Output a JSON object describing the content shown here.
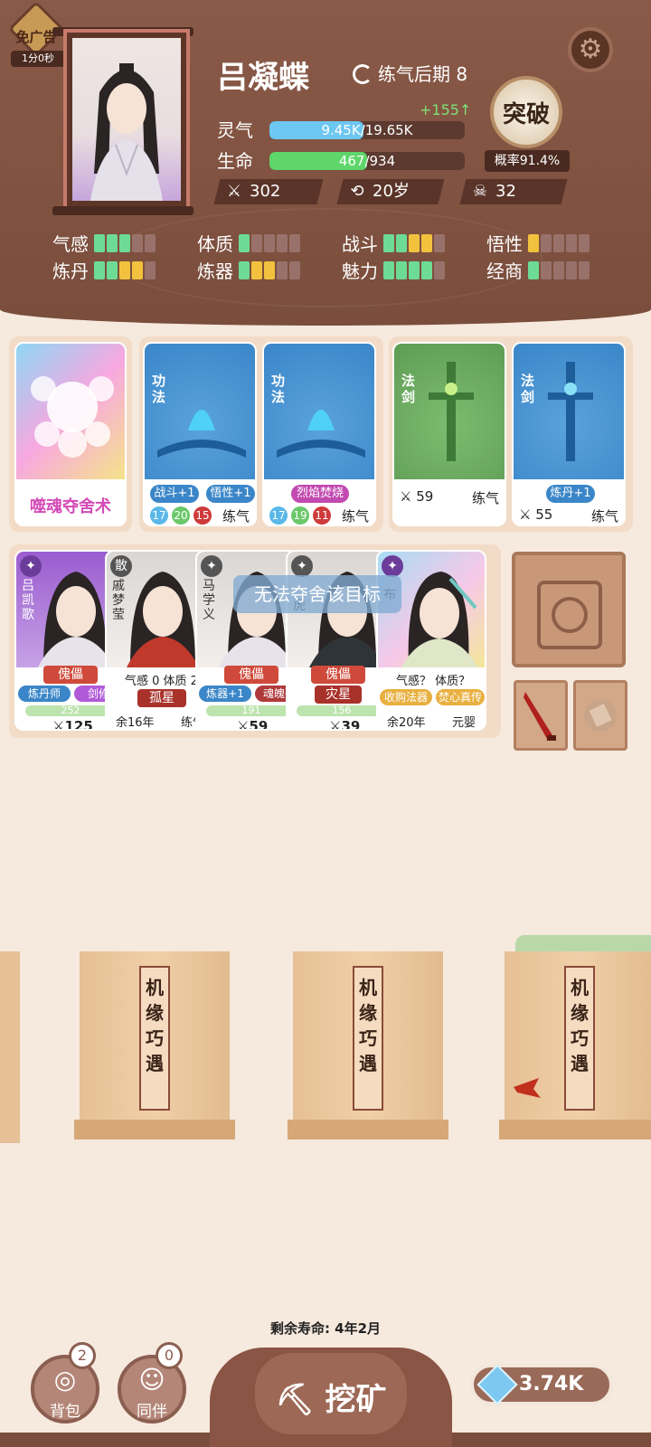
{
  "header": {
    "ad_badge": "免广告",
    "ad_timer": "1分0秒",
    "player_name": "吕凝蝶",
    "realm": "练气后期 8",
    "qi_gain": "+155↑",
    "qi_label": "灵气",
    "qi_value": "9.45K/19.65K",
    "qi_fraction": 0.48,
    "hp_label": "生命",
    "hp_value": "467/934",
    "hp_fraction": 0.5,
    "breakthrough_label": "突破",
    "breakthrough_rate": "概率91.4%",
    "power": "302",
    "age": "20岁",
    "kills": "32"
  },
  "attributes": [
    {
      "label": "气感",
      "pips": [
        "g",
        "g",
        "g",
        "n",
        "n"
      ]
    },
    {
      "label": "体质",
      "pips": [
        "g",
        "n",
        "n",
        "n",
        "n"
      ]
    },
    {
      "label": "战斗",
      "pips": [
        "g",
        "g",
        "y",
        "y",
        "n"
      ]
    },
    {
      "label": "悟性",
      "pips": [
        "y",
        "n",
        "n",
        "n",
        "n"
      ]
    },
    {
      "label": "炼丹",
      "pips": [
        "g",
        "g",
        "y",
        "y",
        "n"
      ]
    },
    {
      "label": "炼器",
      "pips": [
        "g",
        "y",
        "y",
        "n",
        "n"
      ]
    },
    {
      "label": "魅力",
      "pips": [
        "g",
        "g",
        "g",
        "g",
        "n"
      ]
    },
    {
      "label": "经商",
      "pips": [
        "g",
        "n",
        "n",
        "n",
        "n"
      ]
    }
  ],
  "cards": {
    "soul": {
      "title": "噬魂夺舍术"
    },
    "gongfa1": {
      "type": "功法",
      "tag1": "战斗+1",
      "tag2": "悟性+1",
      "n1": "17",
      "n2": "20",
      "n3": "15",
      "realm": "练气"
    },
    "gongfa2": {
      "type": "功法",
      "tag1": "烈焰焚烧",
      "n1": "17",
      "n2": "19",
      "n3": "11",
      "realm": "练气"
    },
    "sword1": {
      "type": "法剑",
      "power": "59",
      "realm": "练气"
    },
    "sword2": {
      "type": "法剑",
      "tag1": "炼丹+1",
      "power": "55",
      "realm": "练气"
    }
  },
  "companions": [
    {
      "name": "吕凯歌",
      "status": "傀儡",
      "tag1": "炼丹师",
      "tag2": "剑修",
      "hp": "252",
      "power": "125"
    },
    {
      "corner": "散",
      "name": "戚梦莹",
      "line1": "气感 0  体质 2",
      "status": "孤星",
      "years": "余16年",
      "realm": "练气"
    },
    {
      "name": "马学义",
      "status": "傀儡",
      "tag1": "炼器+1",
      "tag2": "魂魄残",
      "hp": "191",
      "power": "59"
    },
    {
      "name": "虎",
      "status": "傀儡",
      "status2": "灾星",
      "hp": "156",
      "power": "39"
    },
    {
      "name": "布",
      "line1": "气感？ 体质？",
      "tag1": "收购法器",
      "tag2": "焚心真传",
      "years": "余20年",
      "realm": "元婴"
    }
  ],
  "toast": "无法夺舍该目标",
  "bags": [
    {
      "label": "机缘巧遇"
    },
    {
      "label": "机缘巧遇"
    },
    {
      "label": "机缘巧遇"
    }
  ],
  "bottom": {
    "lifespan": "剩余寿命: 4年2月",
    "backpack_label": "背包",
    "backpack_count": "2",
    "companion_label": "同伴",
    "companion_count": "0",
    "mine_label": "挖矿",
    "gems": "3.74K"
  },
  "colors": {
    "header_bg": "#7a4d3c",
    "qi_bar": "#6cc7f2",
    "hp_bar": "#5ed66a",
    "blue_card": "#3a86c8",
    "green_card": "#6aa860"
  }
}
